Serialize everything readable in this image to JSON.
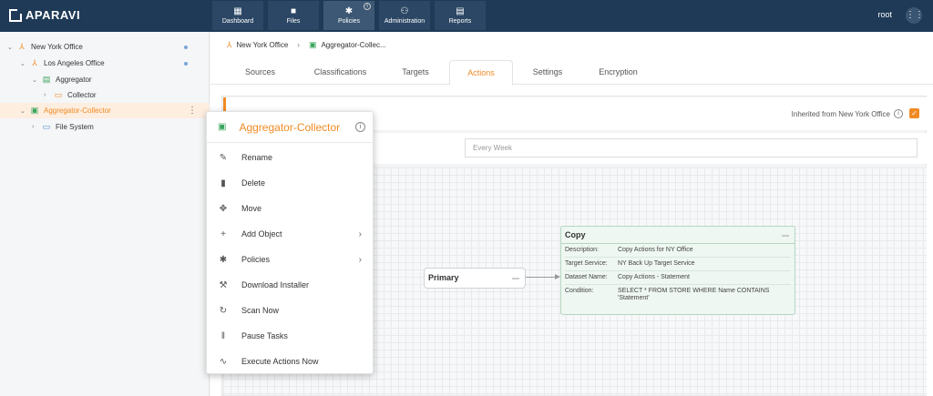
{
  "app": {
    "logo_text": "APARAVI",
    "user": "root"
  },
  "nav": [
    {
      "label": "Dashboard",
      "icon": "▦"
    },
    {
      "label": "Files",
      "icon": "■"
    },
    {
      "label": "Policies",
      "icon": "✱"
    },
    {
      "label": "Administration",
      "icon": "⚇"
    },
    {
      "label": "Reports",
      "icon": "▤"
    }
  ],
  "nav_info": "i",
  "apps_icon": "⋮⋮",
  "tree": [
    {
      "label": "New York Office",
      "chev": "⌄",
      "icon": "⅄"
    },
    {
      "label": "Los Angeles Office",
      "chev": "⌄",
      "icon": "⅄"
    },
    {
      "label": "Aggregator",
      "chev": "⌄",
      "icon": "▤"
    },
    {
      "label": "Collector",
      "chev": "›",
      "icon": "▭"
    },
    {
      "label": "Aggregator-Collector",
      "chev": "⌄",
      "icon": "▣"
    },
    {
      "label": "File System",
      "chev": "›",
      "icon": "▭"
    }
  ],
  "kebab": "⋮",
  "breadcrumb": [
    {
      "label": "New York Office",
      "icon": "⅄"
    },
    {
      "label": "Aggregator-Collec...",
      "icon": "▣"
    }
  ],
  "breadcrumb_sep": "›",
  "tabs": [
    "Sources",
    "Classifications",
    "Targets",
    "Actions",
    "Settings",
    "Encryption"
  ],
  "inherited_text": "Inherited from New York Office",
  "info_glyph": "i",
  "check_glyph": "✓",
  "schedule_value": "Every Week",
  "primary_node": {
    "title": "Primary"
  },
  "copy_node": {
    "title": "Copy",
    "rows": [
      {
        "k": "Description:",
        "v": "Copy Actions for NY Office"
      },
      {
        "k": "Target Service:",
        "v": "NY Back Up Target Service"
      },
      {
        "k": "Dataset Name:",
        "v": "Copy Actions - Statement"
      },
      {
        "k": "Condition:",
        "v": "SELECT * FROM STORE WHERE Name CONTAINS 'Statement'"
      }
    ]
  },
  "menu": {
    "title": "Aggregator-Collector",
    "title_icon": "▣",
    "items": [
      {
        "label": "Rename",
        "icon": "✎"
      },
      {
        "label": "Delete",
        "icon": "▮"
      },
      {
        "label": "Move",
        "icon": "✥"
      },
      {
        "label": "Add Object",
        "icon": "+",
        "arrow": "›"
      },
      {
        "label": "Policies",
        "icon": "✱",
        "arrow": "›"
      },
      {
        "label": "Download Installer",
        "icon": "⚒"
      },
      {
        "label": "Scan Now",
        "icon": "↻"
      },
      {
        "label": "Pause Tasks",
        "icon": "‖"
      },
      {
        "label": "Execute Actions Now",
        "icon": "∿"
      }
    ]
  },
  "colors": {
    "accent": "#f08a24",
    "topbar": "#1f3a57",
    "copy_node_bg": "#eef7f1"
  }
}
